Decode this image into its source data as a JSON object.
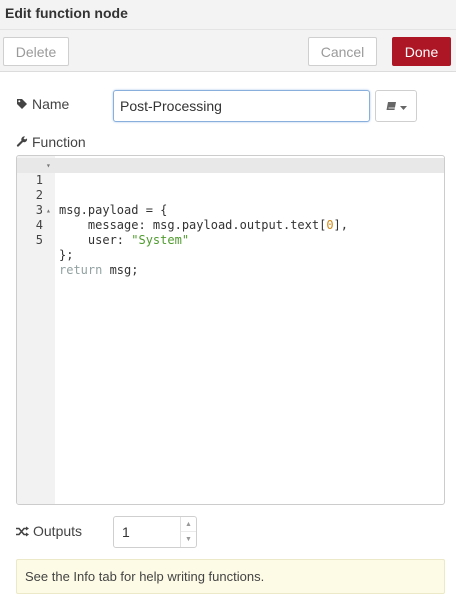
{
  "header": {
    "title": "Edit function node"
  },
  "toolbar": {
    "delete_label": "Delete",
    "cancel_label": "Cancel",
    "done_label": "Done"
  },
  "name_field": {
    "label": "Name",
    "value": "Post-Processing",
    "icon": "tag-icon"
  },
  "icon_picker": {
    "icon": "book-icon",
    "caret": "caret-down-icon"
  },
  "function": {
    "label": "Function",
    "icon": "wrench-icon",
    "lines": [
      {
        "num": "1",
        "fold": "▾",
        "text": "msg.payload = {"
      },
      {
        "num": "2",
        "fold": "",
        "text": "    message: msg.payload.output.text[0],"
      },
      {
        "num": "3",
        "fold": "",
        "text": "    user: \"System\""
      },
      {
        "num": "4",
        "fold": "▴",
        "text": "};"
      },
      {
        "num": "5",
        "fold": "",
        "text": "return msg;"
      }
    ]
  },
  "outputs": {
    "label": "Outputs",
    "value": "1",
    "icon": "shuffle-icon"
  },
  "tip": {
    "text": "See the Info tab for help writing functions."
  },
  "colors": {
    "done_button": "#ad1625",
    "header_bg": "#f3f3f3",
    "tip_bg": "#fdfbe6"
  }
}
